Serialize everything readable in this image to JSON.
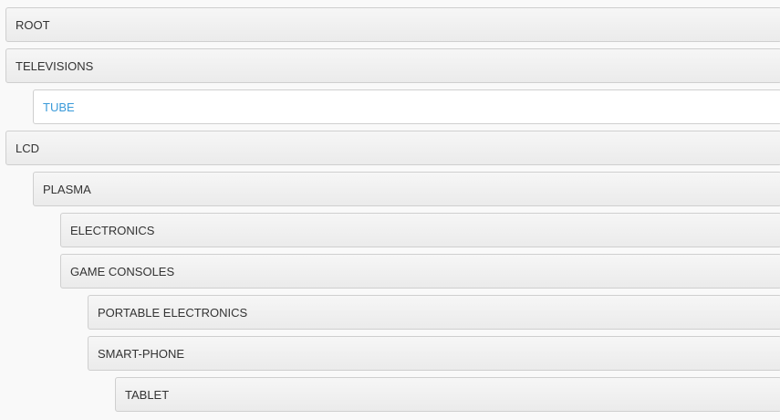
{
  "tree": {
    "items": [
      {
        "label": "ROOT"
      },
      {
        "label": "TELEVISIONS"
      },
      {
        "label": "TUBE"
      },
      {
        "label": "LCD"
      },
      {
        "label": "PLASMA"
      },
      {
        "label": "ELECTRONICS"
      },
      {
        "label": "GAME CONSOLES"
      },
      {
        "label": "PORTABLE ELECTRONICS"
      },
      {
        "label": "SMART-PHONE"
      },
      {
        "label": "TABLET"
      }
    ],
    "active_color": "#3a9ad9"
  }
}
